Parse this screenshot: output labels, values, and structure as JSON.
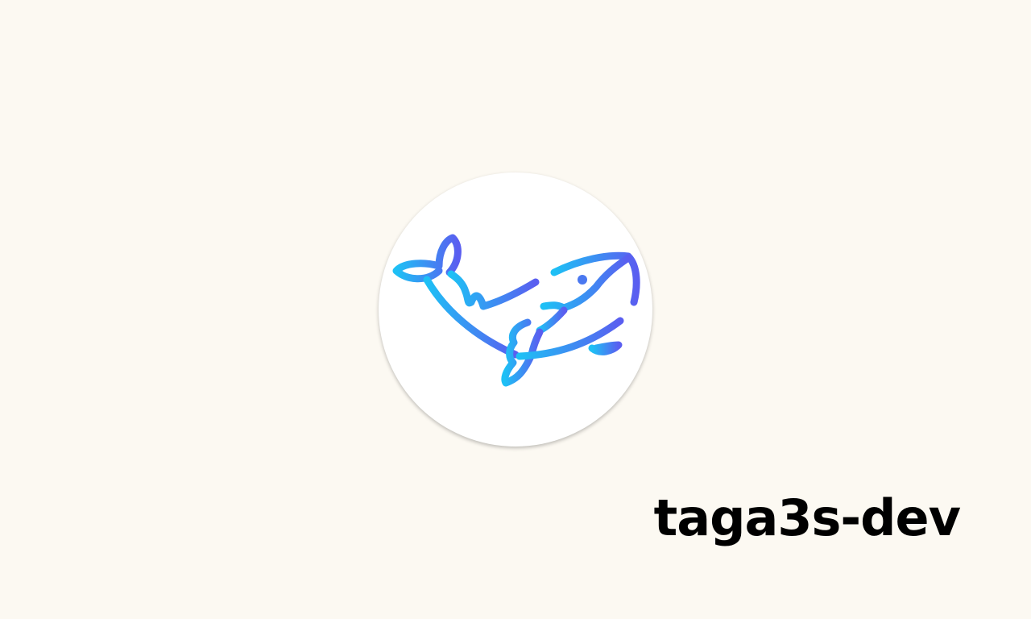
{
  "author": {
    "name": "taga3s-dev"
  },
  "logo": {
    "icon": "whale-icon",
    "gradient_start": "#1ec0f5",
    "gradient_end": "#5a5ef0",
    "background": "#ffffff"
  },
  "page": {
    "background": "#fcf9f2"
  }
}
